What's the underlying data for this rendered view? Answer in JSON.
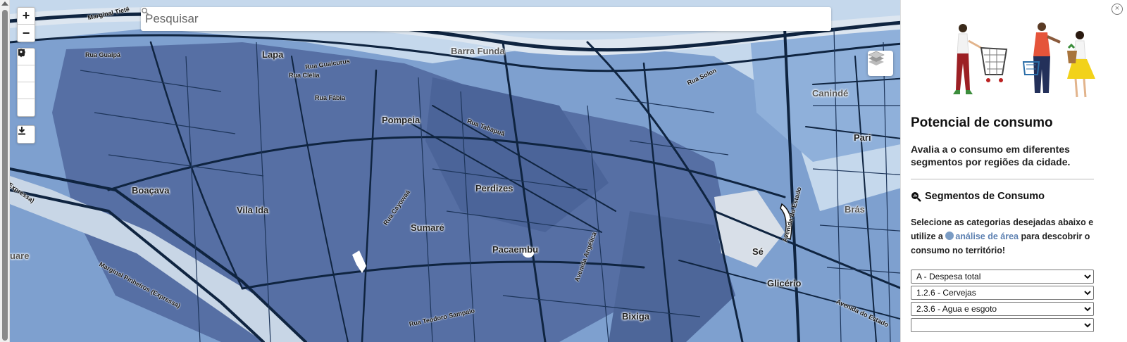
{
  "search": {
    "placeholder": "Pesquisar"
  },
  "controls": {
    "zoom_in": "+",
    "zoom_out": "−",
    "tools": [
      "polygon-icon",
      "square-icon",
      "circle-icon",
      "marker-icon"
    ],
    "export": "download-icon"
  },
  "map": {
    "districts": [
      {
        "name": "Lapa"
      },
      {
        "name": "Barra Funda"
      },
      {
        "name": "Pompeia"
      },
      {
        "name": "Perdizes"
      },
      {
        "name": "Boaçava"
      },
      {
        "name": "Vila Ida"
      },
      {
        "name": "Sumaré"
      },
      {
        "name": "Pacaembu"
      },
      {
        "name": "Bixiga"
      },
      {
        "name": "Glicério"
      },
      {
        "name": "Canindé"
      },
      {
        "name": "Pari"
      },
      {
        "name": "Brás"
      },
      {
        "name": "Sé"
      },
      {
        "name": "uare"
      }
    ],
    "streets": [
      {
        "name": "Marginal Tietê"
      },
      {
        "name": "Rua Guaipá"
      },
      {
        "name": "Rua Guaicurus"
      },
      {
        "name": "Rua Clélia"
      },
      {
        "name": "Rua Fábia"
      },
      {
        "name": "Rua Tabapuã"
      },
      {
        "name": "Rua Cayowaá"
      },
      {
        "name": "Rua Solon"
      },
      {
        "name": "Marginal Pinheiros (Expressa)"
      },
      {
        "name": "(Expressa)"
      },
      {
        "name": "Avenida Angélica"
      },
      {
        "name": "Avenida do Estado"
      },
      {
        "name": "Rua Teodoro Sampaio"
      },
      {
        "name": "Avenida do Estado"
      }
    ],
    "colors": {
      "light": "#c5d8ec",
      "mid": "#6e93c8",
      "dark": "#506a9e",
      "road": "#0f2440"
    }
  },
  "panel": {
    "title": "Potencial de consumo",
    "description": "Avalia a o consumo em diferentes segmentos por regiões da cidade.",
    "section_title": "Segmentos de Consumo",
    "help_pre": "Selecione as categorias desejadas abaixo e utilize a",
    "help_link": "análise de área",
    "help_post": "para descobrir o consumo no território!",
    "selects": [
      {
        "value": "A - Despesa total"
      },
      {
        "value": "1.2.6 - Cervejas"
      },
      {
        "value": "2.3.6 - Agua e esgoto"
      },
      {
        "value": ""
      }
    ]
  }
}
